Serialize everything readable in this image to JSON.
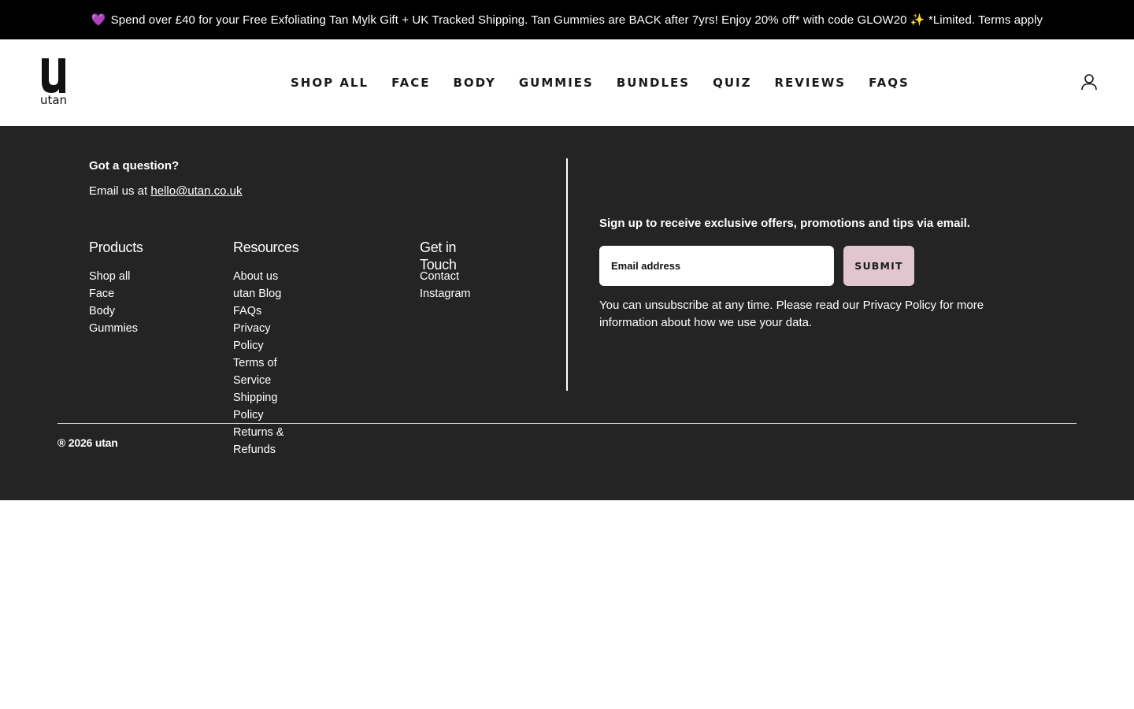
{
  "announcement": {
    "emoji": "💜",
    "text": "Spend over £40 for your Free Exfoliating Tan Mylk Gift + UK Tracked Shipping. Tan Gummies are BACK after 7yrs! Enjoy 20% off* with code GLOW20 ✨ *Limited. Terms apply"
  },
  "header": {
    "logo_text": "utan",
    "nav": [
      {
        "label": "SHOP ALL"
      },
      {
        "label": "FACE"
      },
      {
        "label": "BODY"
      },
      {
        "label": "GUMMIES"
      },
      {
        "label": "BUNDLES"
      },
      {
        "label": "QUIZ"
      },
      {
        "label": "REVIEWS"
      },
      {
        "label": "FAQS"
      }
    ],
    "account_icon": "user-icon"
  },
  "footer": {
    "question_title": "Got a question?",
    "email_prefix": "Email us at",
    "email_link": "hello@utan.co.uk",
    "columns": [
      {
        "title": "Products",
        "links": [
          "Shop all",
          "Face",
          "Body",
          "Gummies"
        ]
      },
      {
        "title": "Resources",
        "links": [
          "About us",
          "utan Blog",
          "FAQs",
          "Privacy Policy",
          "Terms of Service",
          "Shipping Policy",
          "Returns & Refunds"
        ]
      },
      {
        "title": "Get in Touch",
        "links": [
          "Contact",
          "Instagram"
        ]
      }
    ],
    "signup": {
      "title": "Sign up to receive exclusive offers, promotions and tips via email.",
      "placeholder": "Email address",
      "submit_label": "SUBMIT",
      "note_prefix": "You can unsubscribe at any time. Please read our",
      "note_link": "Privacy Policy",
      "note_suffix": "for more information about how we use your data."
    },
    "copyright": "® 2026 utan"
  },
  "colors": {
    "announcement_bg": "#000000",
    "footer_bg": "#242424",
    "submit_bg": "#e2c6cf"
  }
}
